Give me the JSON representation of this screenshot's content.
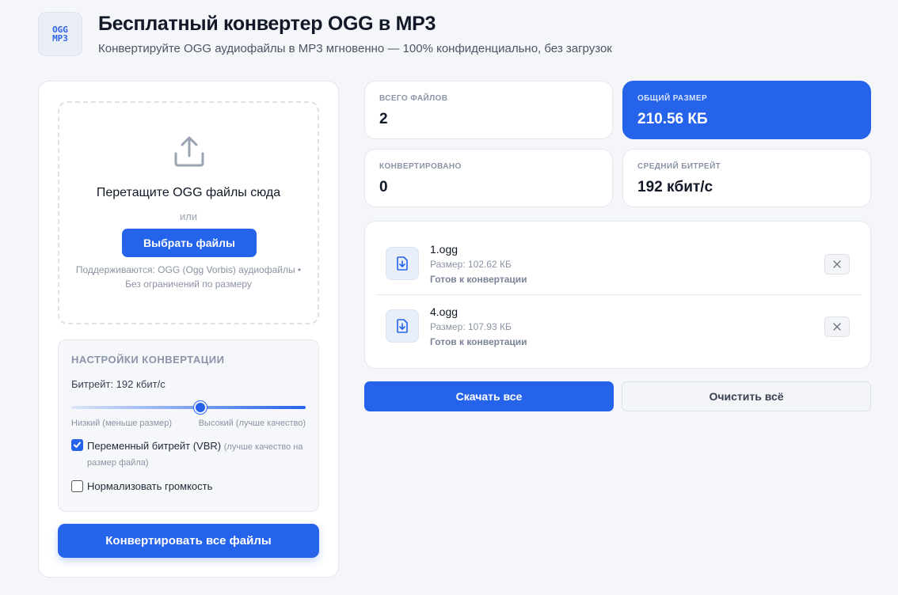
{
  "header": {
    "logo_line1": "OGG",
    "logo_line2": "MP3",
    "title": "Бесплатный конвертер OGG в MP3",
    "subtitle": "Конвертируйте OGG аудиофайлы в MP3 мгновенно — 100% конфиденциально, без загрузок"
  },
  "dropzone": {
    "icon": "upload-icon",
    "title": "Перетащите OGG файлы сюда",
    "or": "или",
    "button": "Выбрать файлы",
    "note": "Поддерживаются: OGG (Ogg Vorbis) аудиофайлы • Без ограничений по размеру"
  },
  "settings": {
    "title": "НАСТРОЙКИ КОНВЕРТАЦИИ",
    "bitrate_label": "Битрейт: 192 кбит/с",
    "slider_value_fraction": 0.55,
    "slider_low": "Низкий (меньше размер)",
    "slider_high": "Высокий (лучше качество)",
    "vbr_label": "Переменный битрейт (VBR)",
    "vbr_hint": "(лучше качество на размер файла)",
    "vbr_checked": true,
    "normalize_label": "Нормализовать громкость",
    "normalize_checked": false
  },
  "convert_button": "Конвертировать все файлы",
  "stats": {
    "total_files_label": "ВСЕГО ФАЙЛОВ",
    "total_files_value": "2",
    "total_size_label": "ОБЩИЙ РАЗМЕР",
    "total_size_value": "210.56 КБ",
    "converted_label": "КОНВЕРТИРОВАНО",
    "converted_value": "0",
    "avg_bitrate_label": "СРЕДНИЙ БИТРЕЙТ",
    "avg_bitrate_value": "192 кбит/с"
  },
  "files": [
    {
      "name": "1.ogg",
      "size": "Размер: 102.62 КБ",
      "status": "Готов к конвертации"
    },
    {
      "name": "4.ogg",
      "size": "Размер: 107.93 КБ",
      "status": "Готов к конвертации"
    }
  ],
  "actions": {
    "download_all": "Скачать все",
    "clear_all": "Очистить всё"
  },
  "colors": {
    "accent": "#2563eb",
    "background": "#f4f6fa"
  }
}
